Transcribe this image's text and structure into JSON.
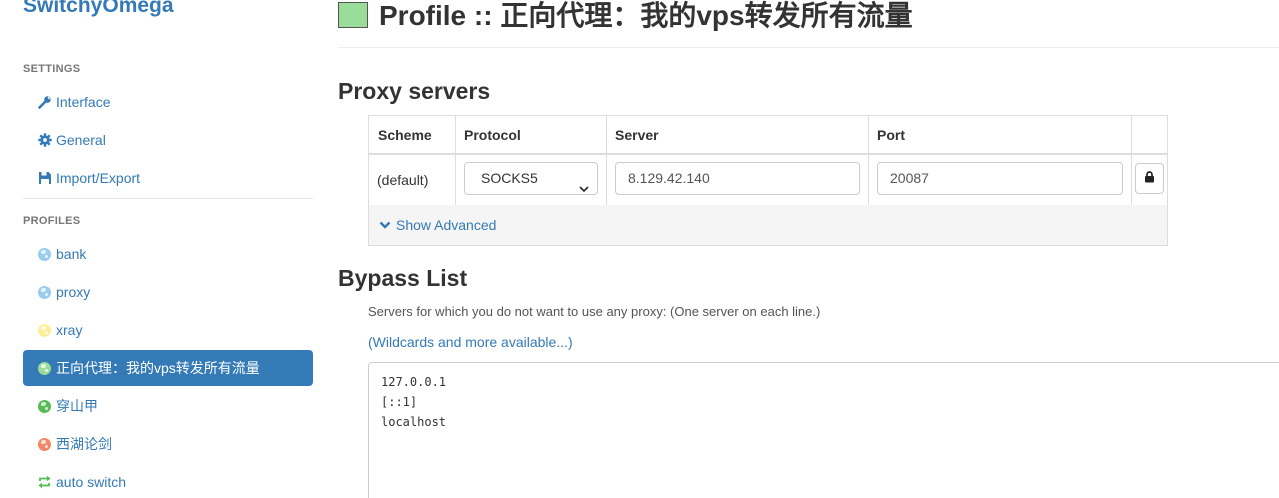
{
  "sidebar": {
    "brand": "SwitchyOmega",
    "settings_label": "SETTINGS",
    "settings_items": [
      {
        "label": "Interface",
        "icon": "wrench-icon"
      },
      {
        "label": "General",
        "icon": "gear-icon"
      },
      {
        "label": "Import/Export",
        "icon": "floppy-disk-icon"
      }
    ],
    "profiles_label": "PROFILES",
    "profiles": [
      {
        "label": "bank",
        "icon": "globe-icon",
        "color": "#99ccee",
        "active": false
      },
      {
        "label": "proxy",
        "icon": "globe-icon",
        "color": "#99ccee",
        "active": false
      },
      {
        "label": "xray",
        "icon": "globe-icon",
        "color": "#ffee99",
        "active": false
      },
      {
        "label": "正向代理：我的vps转发所有流量",
        "icon": "globe-icon",
        "color": "#99dd99",
        "active": true
      },
      {
        "label": "穿山甲",
        "icon": "globe-icon",
        "color": "#55bb55",
        "active": false
      },
      {
        "label": "西湖论剑",
        "icon": "globe-icon",
        "color": "#ee8866",
        "active": false
      },
      {
        "label": "auto switch",
        "icon": "switch-arrows-icon",
        "color": "#55bb55",
        "active": false
      }
    ]
  },
  "header": {
    "title": "Profile :: 正向代理：我的vps转发所有流量",
    "swatch_color": "#99dd99"
  },
  "proxy_servers": {
    "heading": "Proxy servers",
    "columns": [
      "Scheme",
      "Protocol",
      "Server",
      "Port"
    ],
    "row": {
      "scheme": "(default)",
      "protocol": "SOCKS5",
      "server": "8.129.42.140",
      "port": "20087"
    },
    "show_advanced": "Show Advanced"
  },
  "bypass": {
    "heading": "Bypass List",
    "help": "Servers for which you do not want to use any proxy: (One server on each line.)",
    "link": "(Wildcards and more available...)",
    "lines": [
      "127.0.0.1",
      "[::1]",
      "localhost"
    ]
  }
}
